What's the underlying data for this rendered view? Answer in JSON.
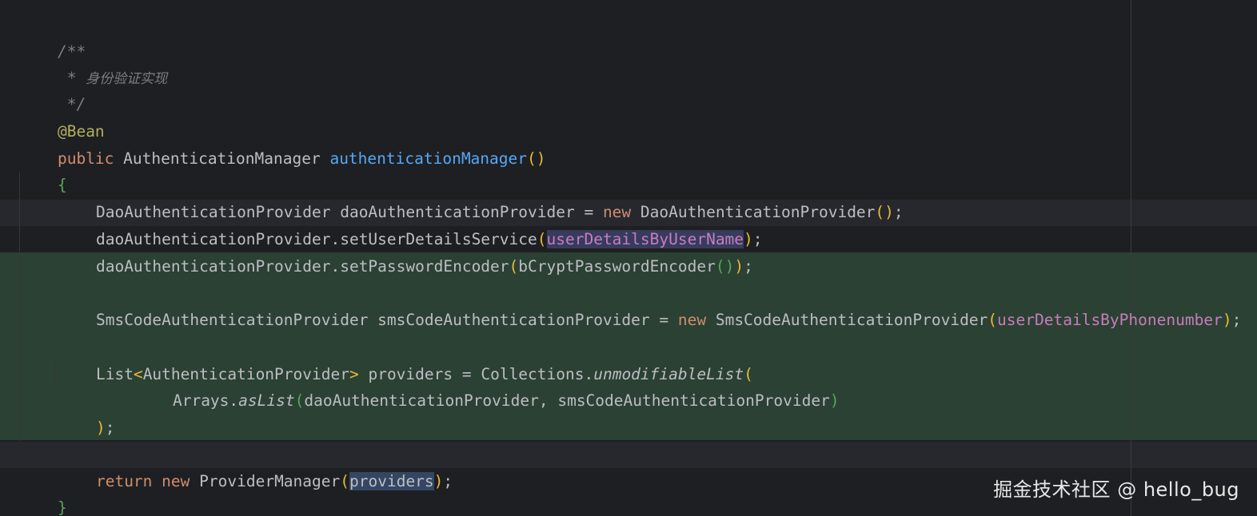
{
  "code": {
    "line1": {
      "text": "/**"
    },
    "line2": {
      "prefix": " * ",
      "cjk": "身份验证实现"
    },
    "line3": {
      "text": " */"
    },
    "line4": {
      "annotation": "@Bean"
    },
    "line5": {
      "kw": "public",
      "type": " AuthenticationManager ",
      "method": "authenticationManager",
      "paren_open": "(",
      "paren_close": ")"
    },
    "line6": {
      "brace": "{"
    },
    "line7": {
      "a": "DaoAuthenticationProvider daoAuthenticationProvider = ",
      "kw": "new",
      "b": " DaoAuthenticationProvider",
      "po": "(",
      "pc": ")",
      "end": ";"
    },
    "line8": {
      "a": "daoAuthenticationProvider.setUserDetailsService",
      "po": "(",
      "arg": "userDetailsByUserName",
      "pc": ")",
      "end": ";"
    },
    "line9": {
      "a": "daoAuthenticationProvider.setPasswordEncoder",
      "po": "(",
      "b": "bCryptPasswordEncoder",
      "po2": "(",
      "pc2": ")",
      "pc": ")",
      "end": ";"
    },
    "line11": {
      "a": "SmsCodeAuthenticationProvider smsCodeAuthenticationProvider = ",
      "kw": "new",
      "b": " SmsCodeAuthenticationProvider",
      "po": "(",
      "arg": "userDetailsByPhonenumber",
      "pc": ")",
      "end": ";"
    },
    "line13": {
      "a": "List",
      "lt": "<",
      "b": "AuthenticationProvider",
      "gt": ">",
      "c": " providers = Collections.",
      "call": "unmodifiableList",
      "po": "("
    },
    "line14": {
      "a": "Arrays.",
      "call": "asList",
      "po": "(",
      "b": "daoAuthenticationProvider, smsCodeAuthenticationProvider",
      "pc": ")"
    },
    "line15": {
      "pc": ")",
      "end": ";"
    },
    "line17": {
      "kw1": "return",
      "sp": " ",
      "kw2": "new",
      "b": " ProviderManager",
      "po": "(",
      "arg": "providers",
      "pc": ")",
      "end": ";"
    },
    "line18": {
      "brace": "}"
    }
  },
  "watermark": "掘金技术社区 @ hello_bug",
  "colors": {
    "background": "#1e1f22",
    "added_block": "#2b4133",
    "keyword": "#cf8e6d",
    "method": "#56a8f5",
    "annotation": "#b3ae60",
    "parameter": "#c77dbb",
    "comment": "#7a7e85"
  }
}
